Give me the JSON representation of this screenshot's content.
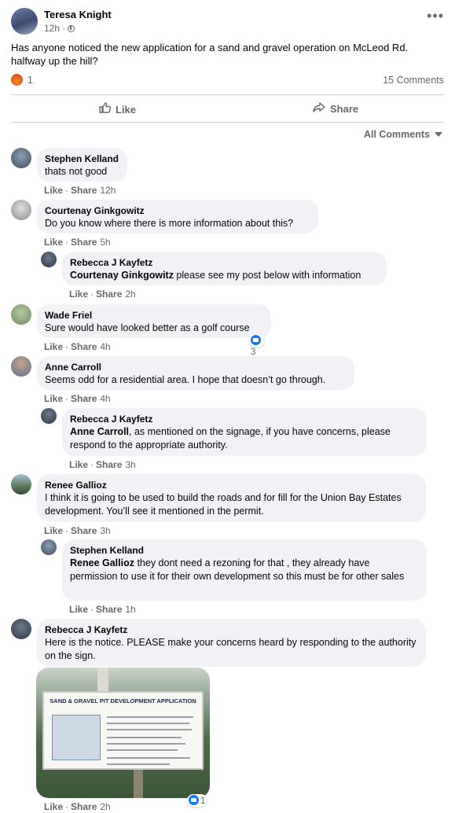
{
  "post": {
    "author": "Teresa Knight",
    "time": "12h ·",
    "more_icon": "•••",
    "text": "Has anyone noticed the new application for a sand and gravel operation on McLeod Rd. halfway up the hill?",
    "reaction_count": "1",
    "comments_count": "15 Comments",
    "like_label": "Like",
    "share_label": "Share",
    "sort_label": "All Comments"
  },
  "comment_actions": {
    "like": "Like",
    "share": "Share",
    "dot": "·"
  },
  "comments": [
    {
      "name": "Stephen Kelland",
      "text": "thats not good",
      "time": "12h"
    },
    {
      "name": "Courtenay Ginkgowitz",
      "text": "Do you know where there is more information about this?",
      "time": "5h"
    },
    {
      "name": "Rebecca J Kayfetz",
      "mention": "Courtenay Ginkgowitz",
      "text": " please see my post below with information",
      "time": "2h"
    },
    {
      "name": "Wade Friel",
      "text": "Sure would have looked better as a golf course",
      "time": "4h",
      "reactions": "3"
    },
    {
      "name": "Anne Carroll",
      "text": "Seems odd for a residential area. I hope that doesn’t go through.",
      "time": "4h"
    },
    {
      "name": "Rebecca J Kayfetz",
      "mention": "Anne Carroll",
      "text": ", as mentioned on the signage, if you have concerns, please respond to the appropriate authority.",
      "time": "3h"
    },
    {
      "name": "Renee Gallioz",
      "text": "I think it is going to be used to build the roads and for fill for the Union Bay Estates development. You’ll see it mentioned in the permit.",
      "time": "3h"
    },
    {
      "name": "Stephen Kelland",
      "mention": "Renee Gallioz",
      "text": " they dont need a rezoning for that , they already have permission to use it for their own development so this must be for other sales",
      "time": "1h"
    },
    {
      "name": "Rebecca J Kayfetz",
      "text": "Here is the notice. PLEASE make your concerns heard by responding to the authority on the sign.",
      "time": "2h",
      "reactions": "1"
    }
  ],
  "sign": {
    "title": "SAND & GRAVEL PIT DEVELOPMENT APPLICATION"
  },
  "colors": {
    "accent": "#1877f2",
    "bubble": "#f0f2f5",
    "muted": "#65676b"
  }
}
